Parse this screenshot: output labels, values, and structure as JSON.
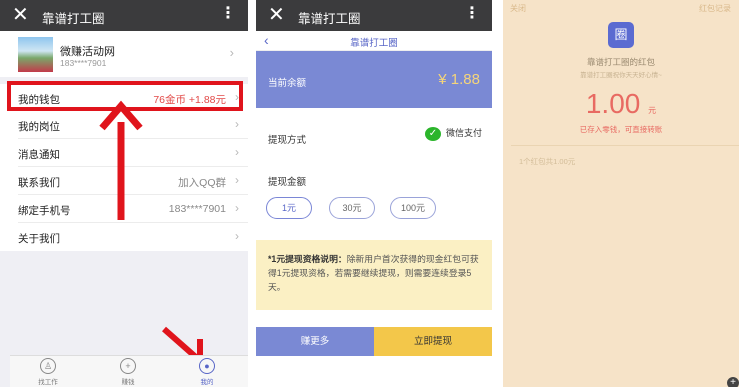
{
  "left_screen": {
    "title": "靠谱打工圈",
    "close_glyph": "✕",
    "more_glyph": "⋮",
    "profile": {
      "name": "微赚活动网",
      "phone": "183****7901"
    },
    "menu": [
      {
        "label": "我的钱包",
        "value": "76金币 +1.88元"
      },
      {
        "label": "我的岗位",
        "value": ""
      },
      {
        "label": "消息通知",
        "value": ""
      },
      {
        "label": "联系我们",
        "value": "加入QQ群"
      },
      {
        "label": "绑定手机号",
        "value": "183****7901"
      },
      {
        "label": "关于我们",
        "value": ""
      }
    ],
    "tabs": [
      {
        "label": "找工作",
        "icon": "bottle-icon"
      },
      {
        "label": "赚钱",
        "icon": "coin-icon"
      },
      {
        "label": "我的",
        "icon": "user-icon"
      }
    ],
    "annotation_color": "#e0141c"
  },
  "middle_screen": {
    "title": "靠谱打工圈",
    "page_title": "靠谱打工圈",
    "balance_label": "当前余额",
    "balance_value": "¥ 1.88",
    "method_label": "提现方式",
    "method_value": "微信支付",
    "amount_label": "提现金额",
    "amounts": [
      "1元",
      "30元",
      "100元"
    ],
    "note_title": "*1元提现资格说明：",
    "note_body": "除新用户首次获得的现金红包可获得1元提现资格，若需要继续提现，则需要连续登录5天。",
    "earn_button": "赚更多",
    "withdraw_button": "立即提现",
    "accent": "#7a89d4"
  },
  "right_screen": {
    "close_label": "关闭",
    "records_label": "红包记录",
    "packet_title": "靠谱打工圈的红包",
    "packet_subtitle": "靠谱打工圈祝你天天好心情~",
    "amount": "1.00",
    "amount_unit": "元",
    "note": "已存入零钱，可直接转账",
    "count_text": "1个红包共1.00元",
    "background": "#f6e3c8"
  }
}
